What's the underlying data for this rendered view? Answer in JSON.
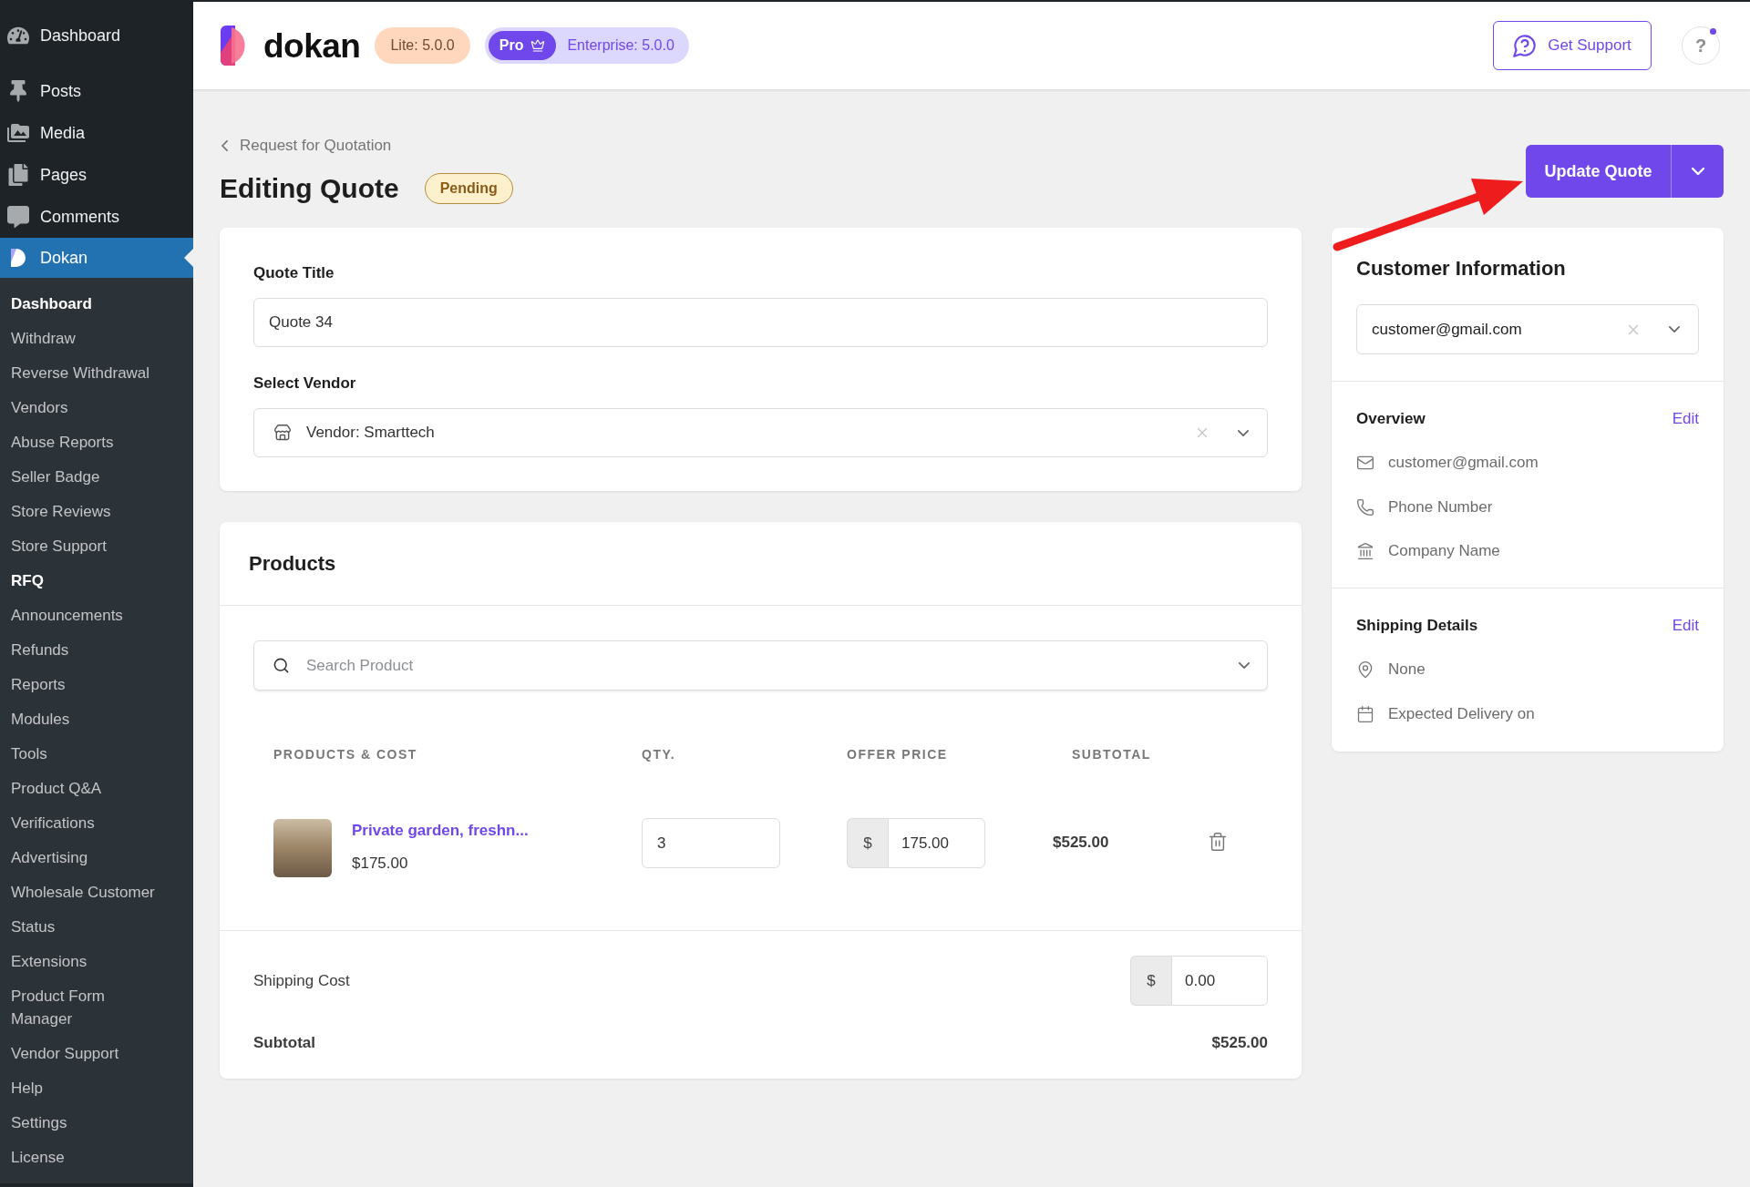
{
  "sidebar": {
    "menu": [
      {
        "label": "Dashboard",
        "selected": false
      },
      {
        "label": "Posts",
        "selected": false
      },
      {
        "label": "Media",
        "selected": false
      },
      {
        "label": "Pages",
        "selected": false
      },
      {
        "label": "Comments",
        "selected": false
      },
      {
        "label": "Dokan",
        "selected": true
      }
    ],
    "submenu": [
      {
        "label": "Dashboard",
        "selected": true
      },
      {
        "label": "Withdraw",
        "selected": false
      },
      {
        "label": "Reverse Withdrawal",
        "selected": false
      },
      {
        "label": "Vendors",
        "selected": false
      },
      {
        "label": "Abuse Reports",
        "selected": false
      },
      {
        "label": "Seller Badge",
        "selected": false
      },
      {
        "label": "Store Reviews",
        "selected": false
      },
      {
        "label": "Store Support",
        "selected": false
      },
      {
        "label": "RFQ",
        "selected": true
      },
      {
        "label": "Announcements",
        "selected": false
      },
      {
        "label": "Refunds",
        "selected": false
      },
      {
        "label": "Reports",
        "selected": false
      },
      {
        "label": "Modules",
        "selected": false
      },
      {
        "label": "Tools",
        "selected": false
      },
      {
        "label": "Product Q&A",
        "selected": false
      },
      {
        "label": "Verifications",
        "selected": false
      },
      {
        "label": "Advertising",
        "selected": false
      },
      {
        "label": "Wholesale Customer",
        "selected": false
      },
      {
        "label": "Status",
        "selected": false
      },
      {
        "label": "Extensions",
        "selected": false
      },
      {
        "label": "Product Form Manager",
        "selected": false
      },
      {
        "label": "Vendor Support",
        "selected": false
      },
      {
        "label": "Help",
        "selected": false
      },
      {
        "label": "Settings",
        "selected": false
      },
      {
        "label": "License",
        "selected": false
      }
    ]
  },
  "header": {
    "logo": "dokan",
    "lite_badge": "Lite: 5.0.0",
    "pro_badge": "Pro",
    "enterprise_badge": "Enterprise: 5.0.0",
    "support_button": "Get Support",
    "help": {
      "label": "?",
      "notification": true
    }
  },
  "page": {
    "breadcrumb": "Request for Quotation",
    "title": "Editing Quote",
    "status": "Pending",
    "primary_action": "Update Quote"
  },
  "quote_form": {
    "title_field": {
      "label": "Quote Title",
      "value": "Quote 34"
    },
    "vendor_field": {
      "label": "Select Vendor",
      "value": "Vendor: Smarttech"
    }
  },
  "products": {
    "title": "Products",
    "search": {
      "placeholder": "Search Product"
    },
    "columns": [
      "PRODUCTS & COST",
      "QTY.",
      "OFFER PRICE",
      "SUBTOTAL"
    ],
    "rows": [
      {
        "name": "Private garden, freshn...",
        "price": "$175.00",
        "qty": "3",
        "currency": "$",
        "offer_price": "175.00",
        "subtotal": "$525.00"
      }
    ],
    "shipping": {
      "label": "Shipping Cost",
      "currency": "$",
      "value": "0.00"
    },
    "subtotal": {
      "label": "Subtotal",
      "value": "$525.00"
    }
  },
  "customer": {
    "title": "Customer Information",
    "select_value": "customer@gmail.com",
    "overview": {
      "title": "Overview",
      "edit": "Edit",
      "items": [
        {
          "kind": "email",
          "text": "customer@gmail.com"
        },
        {
          "kind": "phone",
          "text": "Phone Number"
        },
        {
          "kind": "company",
          "text": "Company Name"
        }
      ]
    },
    "shipping_details": {
      "title": "Shipping Details",
      "edit": "Edit",
      "items": [
        {
          "kind": "location",
          "text": "None"
        },
        {
          "kind": "date",
          "text": "Expected Delivery on"
        }
      ]
    }
  }
}
